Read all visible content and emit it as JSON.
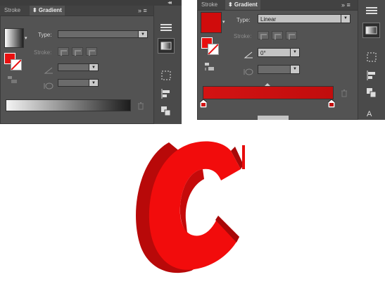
{
  "panel_left": {
    "tabs": [
      {
        "label": "Stroke"
      },
      {
        "label": "⬍ Gradient"
      }
    ],
    "collapse_glyph": "◂◂",
    "menu_glyph": "» ≡",
    "type_label": "Type:",
    "type_value": "",
    "stroke_label": "Stroke:",
    "angle_value": "",
    "aspect_value": ""
  },
  "panel_right": {
    "tabs": [
      {
        "label": "Stroke"
      },
      {
        "label": "⬍ Gradient"
      }
    ],
    "menu_glyph": "» ≡",
    "type_label": "Type:",
    "type_value": "Linear",
    "stroke_label": "Stroke:",
    "angle_value": "0°",
    "aspect_value": ""
  },
  "colors": {
    "panel_bg": "#535353",
    "gradient_red_start": "#d11212",
    "gradient_red_end": "#c30d0d",
    "letter_front": "#f40c0c",
    "letter_side": "#bd0a0a"
  },
  "icons": [
    "trash-icon",
    "angle-icon",
    "aspect-ratio-icon",
    "gradient-swatch-icon",
    "menu-lines-icon",
    "gradient-tool-icon",
    "align-icon",
    "pathfinder-icon",
    "transform-icon"
  ],
  "letter": "C",
  "right_strip_partial_glyph": "A"
}
